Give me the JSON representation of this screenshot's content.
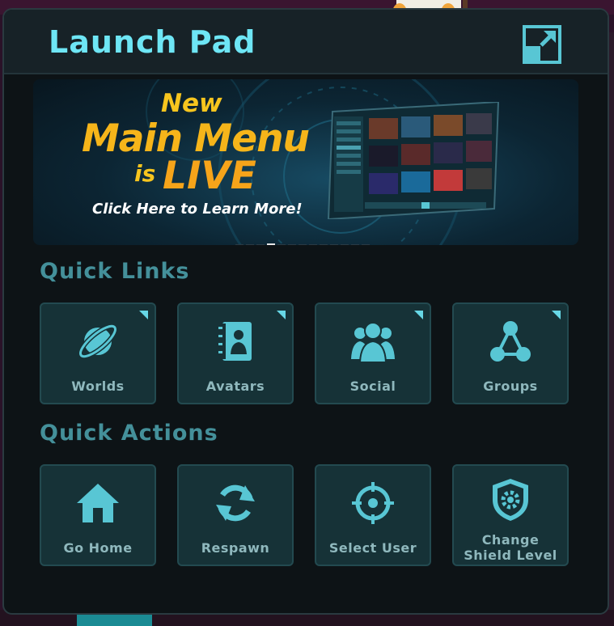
{
  "window": {
    "title": "Launch Pad",
    "expand_icon": "expand-icon"
  },
  "banner": {
    "line1": "New",
    "line2": "Main Menu",
    "line3a": "is",
    "line3b": "LIVE",
    "cta": "Click Here to Learn More!",
    "carousel": {
      "count": 13,
      "active_index": 3
    }
  },
  "quick_links": {
    "title": "Quick Links",
    "items": [
      {
        "label": "Worlds",
        "icon": "planet-icon"
      },
      {
        "label": "Avatars",
        "icon": "avatar-book-icon"
      },
      {
        "label": "Social",
        "icon": "people-icon"
      },
      {
        "label": "Groups",
        "icon": "group-network-icon"
      }
    ]
  },
  "quick_actions": {
    "title": "Quick Actions",
    "items": [
      {
        "label": "Go Home",
        "icon": "home-icon"
      },
      {
        "label": "Respawn",
        "icon": "refresh-icon"
      },
      {
        "label": "Select User",
        "icon": "crosshair-icon"
      },
      {
        "label": "Change Shield Level",
        "line1": "Change",
        "line2": "Shield Level",
        "icon": "shield-gear-icon"
      }
    ]
  },
  "colors": {
    "accent": "#6ee6f5",
    "section_title": "#44909a",
    "tile_bg": "#163237",
    "icon": "#58c6d4",
    "banner_yellow": "#f6b51a"
  }
}
